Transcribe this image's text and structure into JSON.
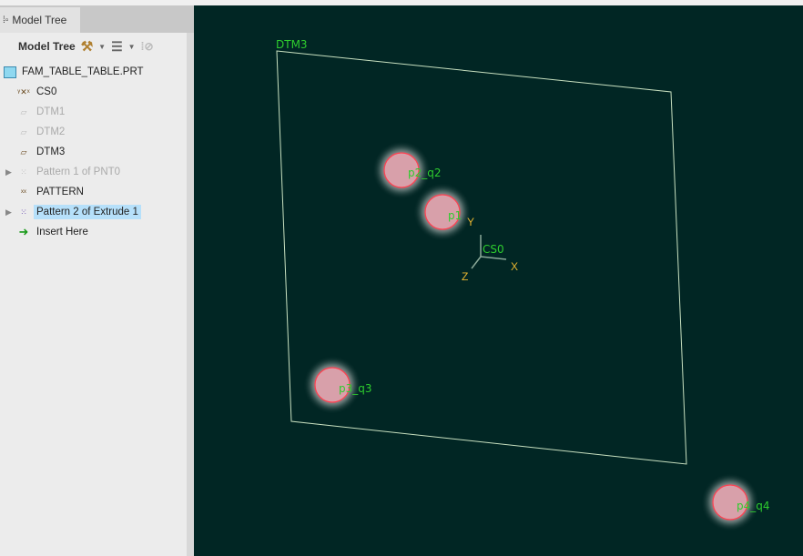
{
  "panel": {
    "tab_label": "Model Tree",
    "toolbar_title": "Model Tree"
  },
  "tree": [
    {
      "label": "FAM_TABLE_TABLE.PRT",
      "icon": "part-icon",
      "dim": false
    },
    {
      "label": "CS0",
      "icon": "csys-icon",
      "dim": false
    },
    {
      "label": "DTM1",
      "icon": "datum-plane-icon",
      "dim": true
    },
    {
      "label": "DTM2",
      "icon": "datum-plane-icon",
      "dim": true
    },
    {
      "label": "DTM3",
      "icon": "datum-plane-icon",
      "dim": false
    },
    {
      "label": "Pattern 1 of PNT0",
      "icon": "pattern-icon",
      "dim": true
    },
    {
      "label": "PATTERN",
      "icon": "datum-point-icon",
      "dim": false
    },
    {
      "label": "Pattern 2 of Extrude 1",
      "icon": "pattern-icon",
      "dim": false,
      "selected": true
    },
    {
      "label": "Insert Here",
      "icon": "insert-arrow-icon",
      "dim": false
    }
  ],
  "viewport": {
    "plane_label": "DTM3",
    "csys_label": "CS0",
    "axis_x": "X",
    "axis_y": "Y",
    "axis_z": "Z",
    "features": [
      "p2_q2",
      "p1",
      "p3_q3",
      "p4_q4"
    ]
  },
  "colors": {
    "background": "#012624",
    "label": "#2ecc2e",
    "axis": "#e8b530",
    "selection": "#b6e0fa"
  }
}
